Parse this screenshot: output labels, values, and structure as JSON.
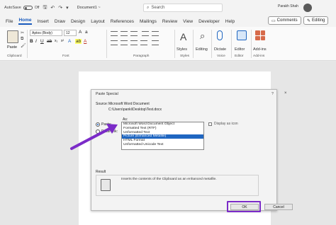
{
  "titlebar": {
    "autosave_label": "AutoSave",
    "autosave_state": "Off",
    "document_title": "Document1 ~",
    "search_placeholder": "Search",
    "user_name": "Parakh Shah"
  },
  "tabs": [
    "File",
    "Home",
    "Insert",
    "Draw",
    "Design",
    "Layout",
    "References",
    "Mailings",
    "Review",
    "View",
    "Developer",
    "Help"
  ],
  "active_tab": "Home",
  "header_buttons": {
    "comments": "Comments",
    "editing": "Editing"
  },
  "ribbon": {
    "paste_label": "Paste",
    "font_name": "Aptos (Body)",
    "font_size": "12",
    "styles_label": "Styles",
    "editing_label": "Editing",
    "dictate_label": "Dictate",
    "editor_label": "Editor",
    "addins_label": "Add-ins",
    "group_labels": {
      "clipboard": "Clipboard",
      "font": "Font",
      "paragraph": "Paragraph",
      "styles": "Styles",
      "voice": "Voice",
      "editor": "Editor",
      "addins": "Add-ins"
    }
  },
  "dialog": {
    "title": "Paste Special",
    "help": "?",
    "close": "×",
    "source_label": "Source:",
    "source_line1": "Microsoft Word Document",
    "source_line2": "C:\\Users\\panki\\Desktop\\Test.docx",
    "as_label": "As:",
    "paste_radio": "Paste:",
    "paste_link_radio": "Paste link:",
    "options": [
      "Microsoft Word Document Object",
      "Formatted Text (RTF)",
      "Unformatted Text",
      "Picture (Enhanced Metafile)",
      "HTML Format",
      "Unformatted Unicode Text"
    ],
    "selected_index": 3,
    "display_as_icon": "Display as icon",
    "result_label": "Result",
    "result_text": "Inserts the contents of the Clipboard as an enhanced metafile.",
    "ok_label": "OK",
    "cancel_label": "Cancel"
  },
  "colors": {
    "accent": "#185abd",
    "selection": "#1f66c1",
    "annotation": "#7b2bc8"
  }
}
